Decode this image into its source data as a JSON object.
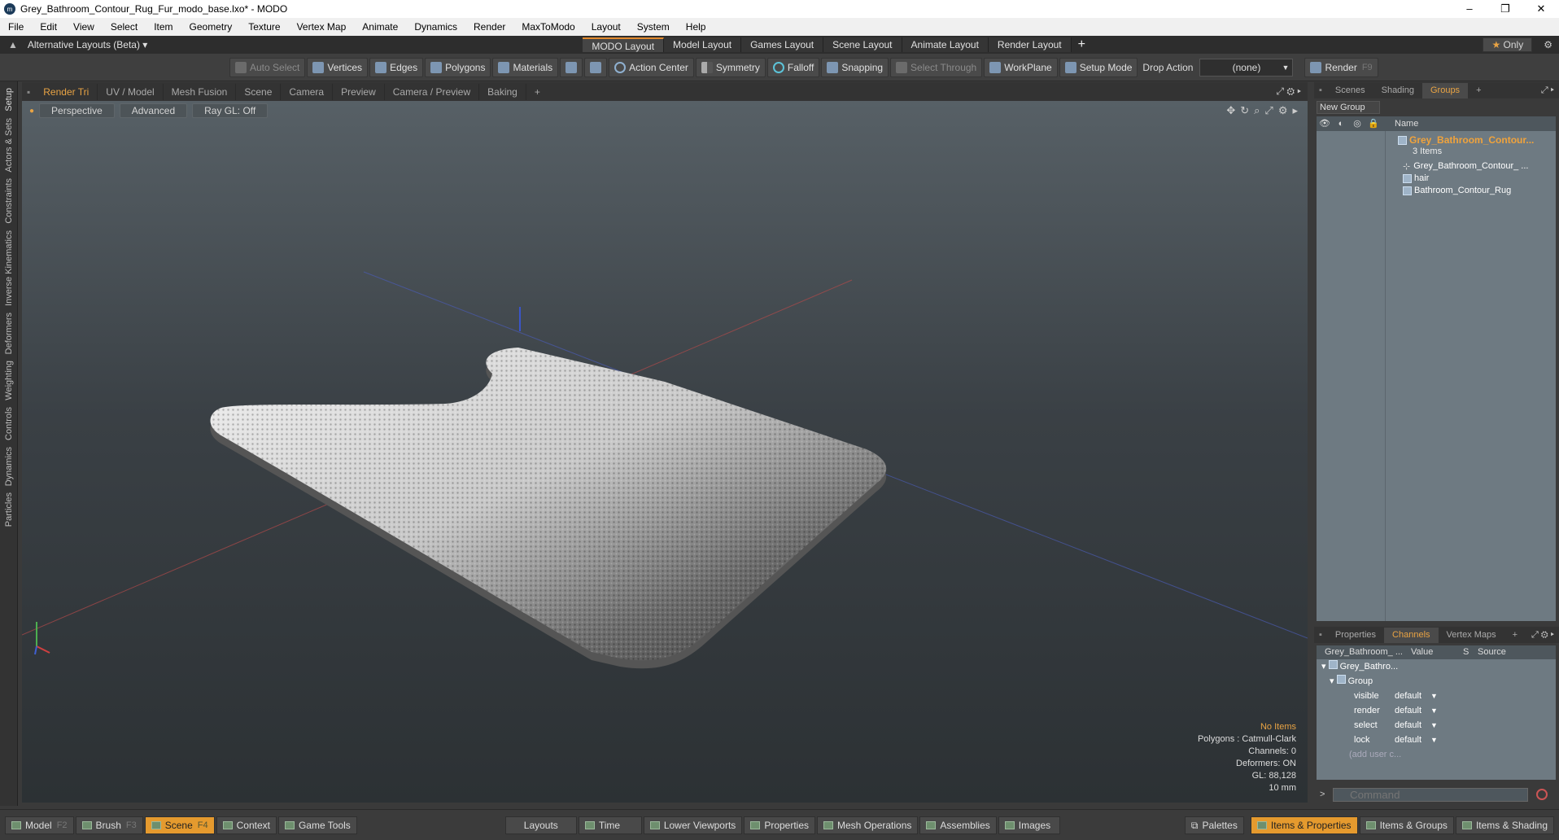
{
  "window": {
    "title": "Grey_Bathroom_Contour_Rug_Fur_modo_base.lxo* - MODO",
    "controls": [
      "–",
      "❐",
      "✕"
    ]
  },
  "menu": [
    "File",
    "Edit",
    "View",
    "Select",
    "Item",
    "Geometry",
    "Texture",
    "Vertex Map",
    "Animate",
    "Dynamics",
    "Render",
    "MaxToModo",
    "Layout",
    "System",
    "Help"
  ],
  "layouts": {
    "selector": "Alternative Layouts (Beta)",
    "tabs": [
      "MODO Layout",
      "Model Layout",
      "Games Layout",
      "Scene Layout",
      "Animate Layout",
      "Render Layout"
    ],
    "add": "+",
    "only": "Only"
  },
  "toolbar": {
    "auto_select": "Auto Select",
    "vertices": "Vertices",
    "edges": "Edges",
    "polygons": "Polygons",
    "materials": "Materials",
    "action_center": "Action Center",
    "symmetry": "Symmetry",
    "falloff": "Falloff",
    "snapping": "Snapping",
    "select_through": "Select Through",
    "workplane": "WorkPlane",
    "setup_mode": "Setup Mode",
    "drop_action": "Drop Action",
    "drop_value": "(none)",
    "render": "Render",
    "render_key": "F9"
  },
  "left_tabs": [
    "Setup",
    "Actors & Sets",
    "Constraints",
    "Inverse Kinematics",
    "Deformers",
    "Weighting",
    "Controls",
    "Dynamics",
    "Particles"
  ],
  "viewport_tabs": [
    "Render Tri",
    "UV / Model",
    "Mesh Fusion",
    "Scene",
    "Camera",
    "Preview",
    "Camera / Preview",
    "Baking",
    "+"
  ],
  "viewport_opts": {
    "view": "Perspective",
    "shading": "Advanced",
    "raygl": "Ray GL: Off"
  },
  "viewport_info": {
    "items": "No Items",
    "polygons": "Polygons : Catmull-Clark",
    "channels": "Channels: 0",
    "deformers": "Deformers: ON",
    "gl": "GL: 88,128",
    "unit": "10 mm"
  },
  "right_tabs": [
    "Scenes",
    "Shading",
    "Groups",
    "+"
  ],
  "groups": {
    "new_group": "New Group",
    "col_name": "Name",
    "root": "Grey_Bathroom_Contour...",
    "count": "3 Items",
    "children": [
      "Grey_Bathroom_Contour_ ...",
      "hair",
      "Bathroom_Contour_Rug"
    ]
  },
  "channel_tabs": [
    "Properties",
    "Channels",
    "Vertex Maps",
    "+"
  ],
  "channels": {
    "headers": [
      "Grey_Bathroom_ ...",
      "Value",
      "S",
      "Source"
    ],
    "item": "Grey_Bathro...",
    "group": "Group",
    "rows": [
      {
        "name": "visible",
        "value": "default"
      },
      {
        "name": "render",
        "value": "default"
      },
      {
        "name": "select",
        "value": "default"
      },
      {
        "name": "lock",
        "value": "default"
      }
    ],
    "add": "(add user c..."
  },
  "command_placeholder": "Command",
  "bottom": {
    "left": [
      {
        "label": "Model",
        "key": "F2"
      },
      {
        "label": "Brush",
        "key": "F3"
      },
      {
        "label": "Scene",
        "key": "F4"
      },
      {
        "label": "Context",
        "key": ""
      },
      {
        "label": "Game Tools",
        "key": ""
      }
    ],
    "center": [
      "Layouts",
      "Time",
      "Lower Viewports",
      "Properties",
      "Mesh Operations",
      "Assemblies",
      "Images"
    ],
    "right": [
      "Palettes",
      "Items & Properties",
      "Items & Groups",
      "Items & Shading"
    ]
  }
}
